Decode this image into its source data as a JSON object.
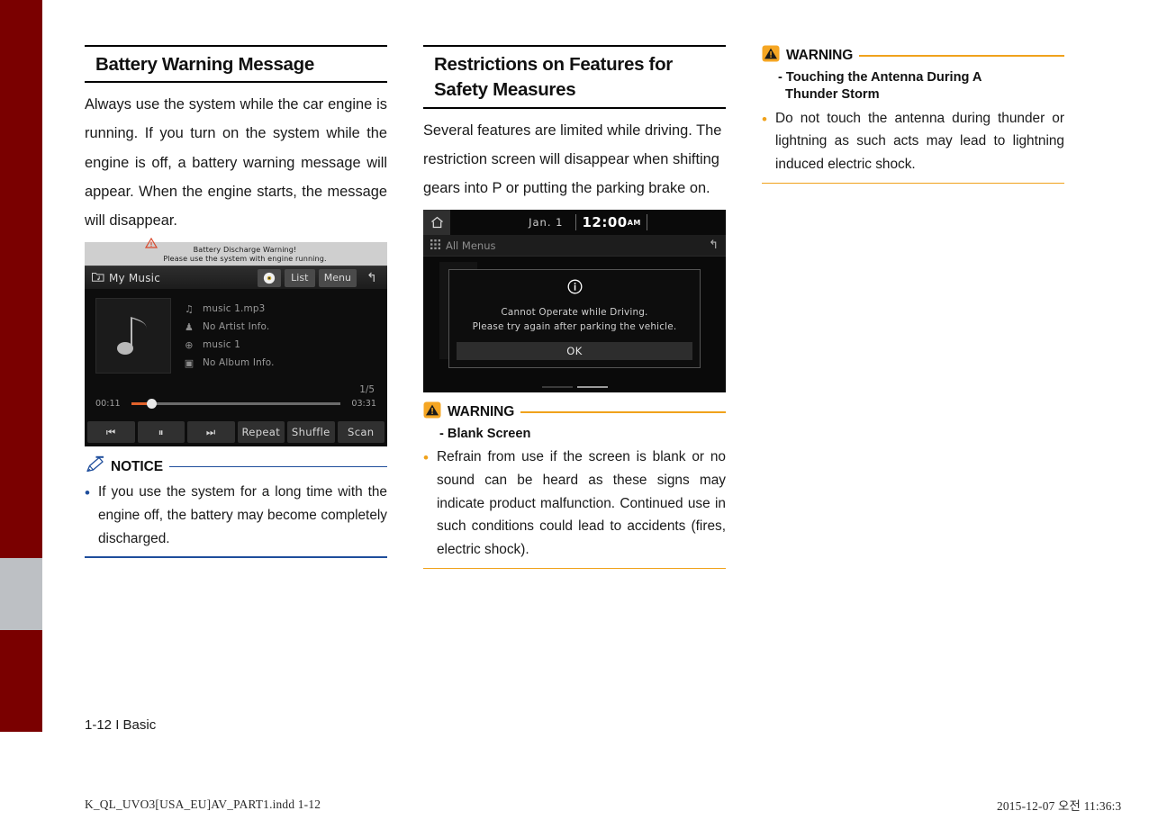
{
  "page": {
    "folio": "1-12 I Basic",
    "imprint_left": "K_QL_UVO3[USA_EU]AV_PART1.indd   1-12",
    "imprint_right": "2015-12-07   오전 11:36:3",
    "accent_notice": "#1f4e9c",
    "accent_warning": "#f0a21c",
    "binding_color": "#7a0000",
    "binding_tab_color": "#bdc0c4"
  },
  "col1": {
    "heading": "Battery Warning Message",
    "paragraph": "Always use the system while the car engine is running. If you turn on the system while the engine is off, a battery warning message will appear. When the engine starts, the message will disappear.",
    "player": {
      "warning_line1": "Battery Discharge Warning!",
      "warning_line2": "Please use the system with engine running.",
      "title": "My Music",
      "btn_list": "List",
      "btn_menu": "Menu",
      "meta": [
        {
          "icon": "note-icon",
          "glyph": "♫",
          "text": "music 1.mp3"
        },
        {
          "icon": "person-icon",
          "glyph": "♟",
          "text": "No Artist Info."
        },
        {
          "icon": "genre-icon",
          "glyph": "⊕",
          "text": "music 1"
        },
        {
          "icon": "album-icon",
          "glyph": "▣",
          "text": "No Album Info."
        }
      ],
      "track_count": "1/5",
      "elapsed": "00:11",
      "duration": "03:31",
      "controls": [
        "⏮",
        "⏸",
        "⏭",
        "Repeat",
        "Shuffle",
        "Scan"
      ]
    },
    "notice": {
      "label": "NOTICE",
      "bullets": [
        "If you use the system for a long time with the engine off, the battery may become completely discharged."
      ]
    }
  },
  "col2": {
    "heading": "Restrictions on Features for Safety Measures",
    "paragraph": "Several features are limited while driving. The restriction screen will disappear when shifting gears into P or putting the parking brake on.",
    "restriction": {
      "date": "Jan.  1",
      "clock": "12:00",
      "ampm": "AM",
      "menu_label": "All Menus",
      "modal_line1": "Cannot Operate while Driving.",
      "modal_line2": "Please try again after parking the vehicle.",
      "ok_label": "OK"
    },
    "warning": {
      "label": "WARNING",
      "subtitle": "- Blank Screen",
      "bullets": [
        "Refrain from use if the screen is blank or no sound can be heard as these signs may indicate product malfunction. Continued use in such conditions could lead to accidents (fires, electric shock)."
      ]
    }
  },
  "col3": {
    "warning": {
      "label": "WARNING",
      "subtitle_line1": "- Touching the Antenna During A",
      "subtitle_line2": "Thunder Storm",
      "bullets": [
        "Do not touch the antenna during thunder or lightning as such acts may lead to lightning induced electric shock."
      ]
    }
  }
}
